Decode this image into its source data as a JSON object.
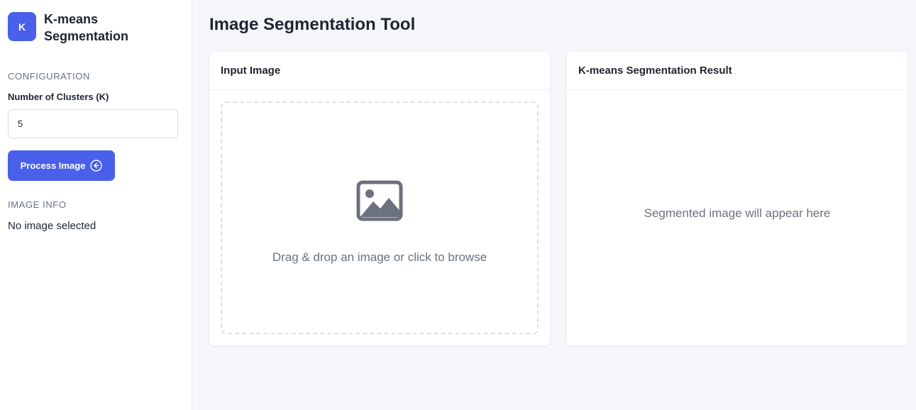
{
  "sidebar": {
    "logo_letter": "K",
    "brand_name": "K-means Segmentation",
    "config_label": "CONFIGURATION",
    "clusters_label": "Number of Clusters (K)",
    "clusters_value": "5",
    "process_button": "Process Image",
    "info_label": "IMAGE INFO",
    "info_text": "No image selected"
  },
  "main": {
    "title": "Image Segmentation Tool",
    "input_card": {
      "title": "Input Image",
      "drop_text": "Drag & drop an image or click to browse"
    },
    "result_card": {
      "title": "K-means Segmentation Result",
      "placeholder": "Segmented image will appear here"
    }
  },
  "colors": {
    "accent": "#4a60ea",
    "muted_text": "#6b7280",
    "icon_gray": "#6b717d"
  },
  "icons": {
    "process": "arrow-left-circle-icon",
    "upload": "image-icon"
  }
}
